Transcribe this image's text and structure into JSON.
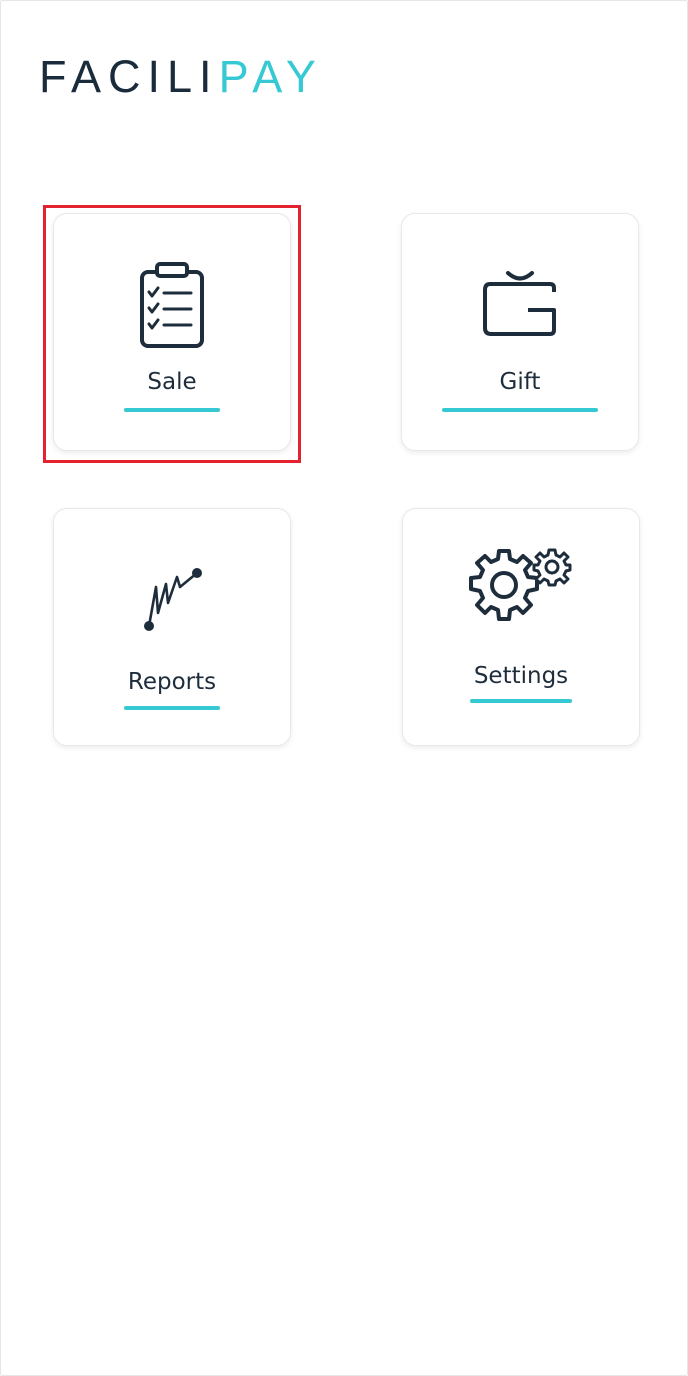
{
  "app": {
    "logo_primary": "FACILI",
    "logo_accent": "PAY",
    "brand_dark": "#1a2b3c",
    "brand_accent": "#36c9d4"
  },
  "menu": {
    "tiles": [
      {
        "label": "Sale",
        "icon": "clipboard-checklist-icon"
      },
      {
        "label": "Gift",
        "icon": "wallet-icon"
      },
      {
        "label": "Reports",
        "icon": "line-chart-icon"
      },
      {
        "label": "Settings",
        "icon": "gears-icon"
      }
    ]
  },
  "selection": {
    "highlighted_tile": "Sale",
    "highlight_color": "#e2222e"
  }
}
